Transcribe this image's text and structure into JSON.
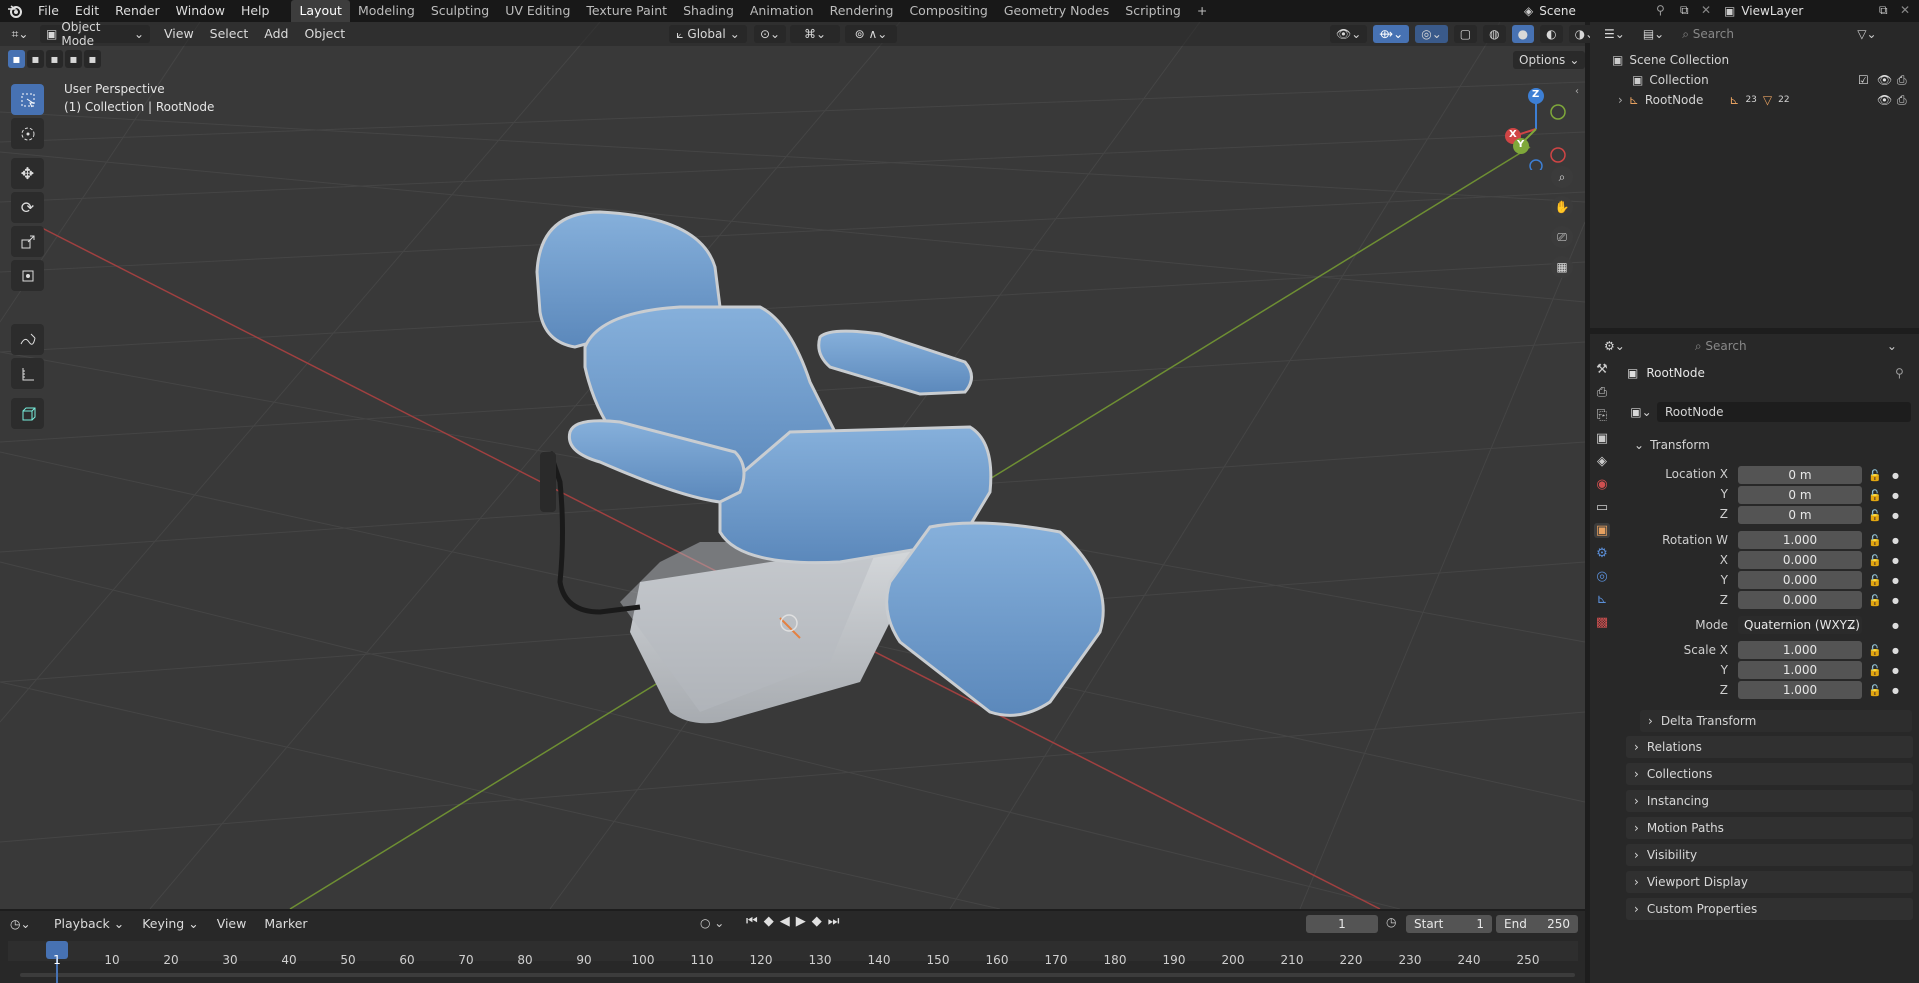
{
  "menus": [
    "File",
    "Edit",
    "Render",
    "Window",
    "Help"
  ],
  "workspaces": [
    "Layout",
    "Modeling",
    "Sculpting",
    "UV Editing",
    "Texture Paint",
    "Shading",
    "Animation",
    "Rendering",
    "Compositing",
    "Geometry Nodes",
    "Scripting"
  ],
  "scene": {
    "name": "Scene",
    "view_layer": "ViewLayer"
  },
  "viewport": {
    "mode": "Object Mode",
    "menus": [
      "View",
      "Select",
      "Add",
      "Object"
    ],
    "orientation": "Global",
    "options": "Options",
    "perspective": "User Perspective",
    "collection_info": "(1) Collection | RootNode",
    "gizmo": {
      "x": "X",
      "y": "Y",
      "z": "Z"
    }
  },
  "outliner": {
    "search_placeholder": "Search",
    "items": [
      {
        "label": "Scene Collection"
      },
      {
        "label": "Collection"
      },
      {
        "label": "RootNode",
        "count_a": "23",
        "count_b": "22"
      }
    ]
  },
  "properties": {
    "search_placeholder": "Search",
    "object_name": "RootNode",
    "data_name": "RootNode",
    "transform_label": "Transform",
    "location_label": "Location X",
    "location": [
      "0 m",
      "0 m",
      "0 m"
    ],
    "rotation_label": "Rotation W",
    "rotation": [
      "1.000",
      "0.000",
      "0.000",
      "0.000"
    ],
    "mode_label": "Mode",
    "mode_value": "Quaternion (WXYZ)",
    "scale_label": "Scale X",
    "scale": [
      "1.000",
      "1.000",
      "1.000"
    ],
    "axis_y": "Y",
    "axis_z": "Z",
    "axis_x": "X",
    "delta": "Delta Transform",
    "panels": [
      "Relations",
      "Collections",
      "Instancing",
      "Motion Paths",
      "Visibility",
      "Viewport Display",
      "Custom Properties"
    ]
  },
  "timeline": {
    "menus": [
      "Playback",
      "Keying",
      "View",
      "Marker"
    ],
    "current_frame": "1",
    "start_label": "Start",
    "start": "1",
    "end_label": "End",
    "end": "250",
    "ticks": [
      "1",
      "10",
      "20",
      "30",
      "40",
      "50",
      "60",
      "70",
      "80",
      "90",
      "100",
      "110",
      "120",
      "130",
      "140",
      "150",
      "160",
      "170",
      "180",
      "190",
      "200",
      "210",
      "220",
      "230",
      "240",
      "250"
    ]
  },
  "colors": {
    "accent": "#4772b3",
    "x_axis": "#d04545",
    "y_axis": "#7fa83a",
    "z_axis": "#3d7fd4",
    "seat": "#6f9ccc",
    "base": "#c8ccd0"
  }
}
